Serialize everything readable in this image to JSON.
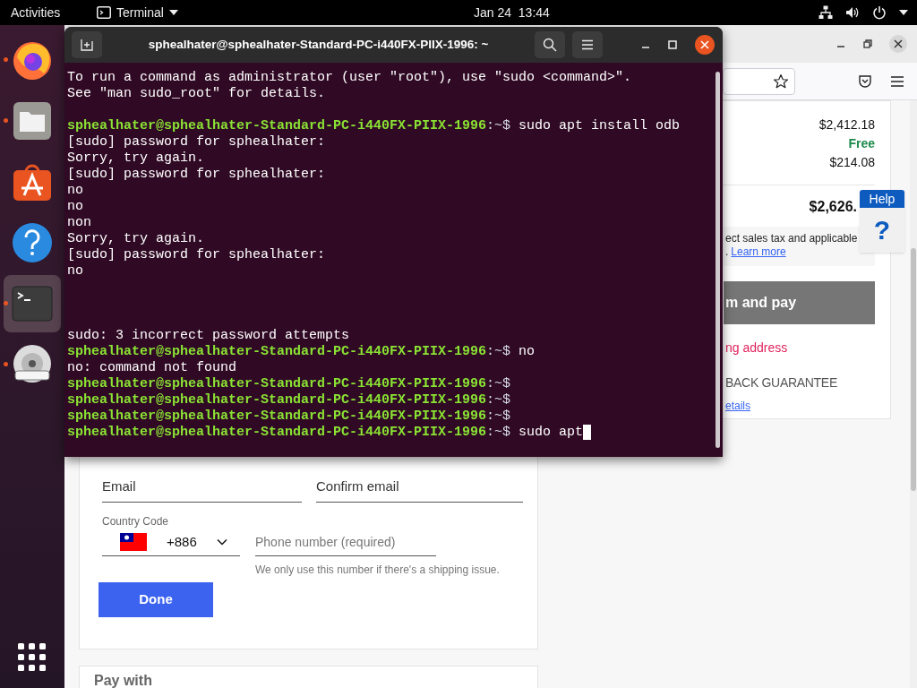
{
  "top_bar": {
    "activities": "Activities",
    "app_menu": "Terminal",
    "clock": "Jan 24  13:44"
  },
  "dock": {
    "items": [
      {
        "kind": "firefox",
        "running": true,
        "selected": false
      },
      {
        "kind": "files",
        "running": true,
        "selected": false
      },
      {
        "kind": "software",
        "running": false,
        "selected": false
      },
      {
        "kind": "help",
        "running": false,
        "selected": false
      },
      {
        "kind": "terminal",
        "running": true,
        "selected": true
      },
      {
        "kind": "dvd",
        "running": true,
        "selected": false
      }
    ]
  },
  "browser": {
    "summary": {
      "rows": [
        {
          "kind": "amount",
          "value": "$2,412.18"
        },
        {
          "kind": "free",
          "value": "Free"
        },
        {
          "kind": "amount",
          "value": "$214.08"
        }
      ],
      "total": "$2,626.",
      "tax_note": "ect sales tax and applicable",
      "tax_note_end": ".",
      "learn_more": "Learn more",
      "pay_button": "m and pay",
      "address_warning": "ng address",
      "guarantee": "BACK GUARANTEE",
      "details_link": "etails"
    },
    "help": {
      "label": "Help",
      "icon": "?"
    },
    "contact_form": {
      "email": {
        "placeholder": "Email"
      },
      "confirm_email": {
        "placeholder": "Confirm email"
      },
      "country_code_label": "Country Code",
      "country_code": "+886",
      "phone": {
        "placeholder": "Phone number (required)"
      },
      "phone_hint": "We only use this number if there's a shipping issue.",
      "done_button": "Done"
    },
    "payment": {
      "heading": "Pay with"
    }
  },
  "terminal": {
    "title": "sphealhater@sphealhater-Standard-PC-i440FX-PIIX-1996: ~",
    "lines": [
      {
        "kind": "output",
        "text": "To run a command as administrator (user \"root\"), use \"sudo <command>\"."
      },
      {
        "kind": "output",
        "text": "See \"man sudo_root\" for details."
      },
      {
        "kind": "blank"
      },
      {
        "kind": "prompt",
        "user_host": "sphealhater@sphealhater-Standard-PC-i440FX-PIIX-1996",
        "path": ":~$",
        "command": "sudo apt install odb",
        "cursor": false
      },
      {
        "kind": "output",
        "text": "[sudo] password for sphealhater:"
      },
      {
        "kind": "output",
        "text": "Sorry, try again."
      },
      {
        "kind": "output",
        "text": "[sudo] password for sphealhater:"
      },
      {
        "kind": "output",
        "text": "no"
      },
      {
        "kind": "output",
        "text": "no"
      },
      {
        "kind": "output",
        "text": "non"
      },
      {
        "kind": "output",
        "text": "Sorry, try again."
      },
      {
        "kind": "output",
        "text": "[sudo] password for sphealhater:"
      },
      {
        "kind": "output",
        "text": "no"
      },
      {
        "kind": "blank"
      },
      {
        "kind": "blank"
      },
      {
        "kind": "blank"
      },
      {
        "kind": "output",
        "text": "sudo: 3 incorrect password attempts"
      },
      {
        "kind": "prompt",
        "user_host": "sphealhater@sphealhater-Standard-PC-i440FX-PIIX-1996",
        "path": ":~$",
        "command": "no",
        "cursor": false
      },
      {
        "kind": "output",
        "text": "no: command not found"
      },
      {
        "kind": "prompt",
        "user_host": "sphealhater@sphealhater-Standard-PC-i440FX-PIIX-1996",
        "path": ":~$",
        "cursor": false
      },
      {
        "kind": "prompt",
        "user_host": "sphealhater@sphealhater-Standard-PC-i440FX-PIIX-1996",
        "path": ":~$",
        "cursor": false
      },
      {
        "kind": "prompt",
        "user_host": "sphealhater@sphealhater-Standard-PC-i440FX-PIIX-1996",
        "path": ":~$",
        "cursor": false
      },
      {
        "kind": "prompt",
        "user_host": "sphealhater@sphealhater-Standard-PC-i440FX-PIIX-1996",
        "path": ":~$",
        "command": "sudo apt",
        "cursor": true
      }
    ]
  }
}
